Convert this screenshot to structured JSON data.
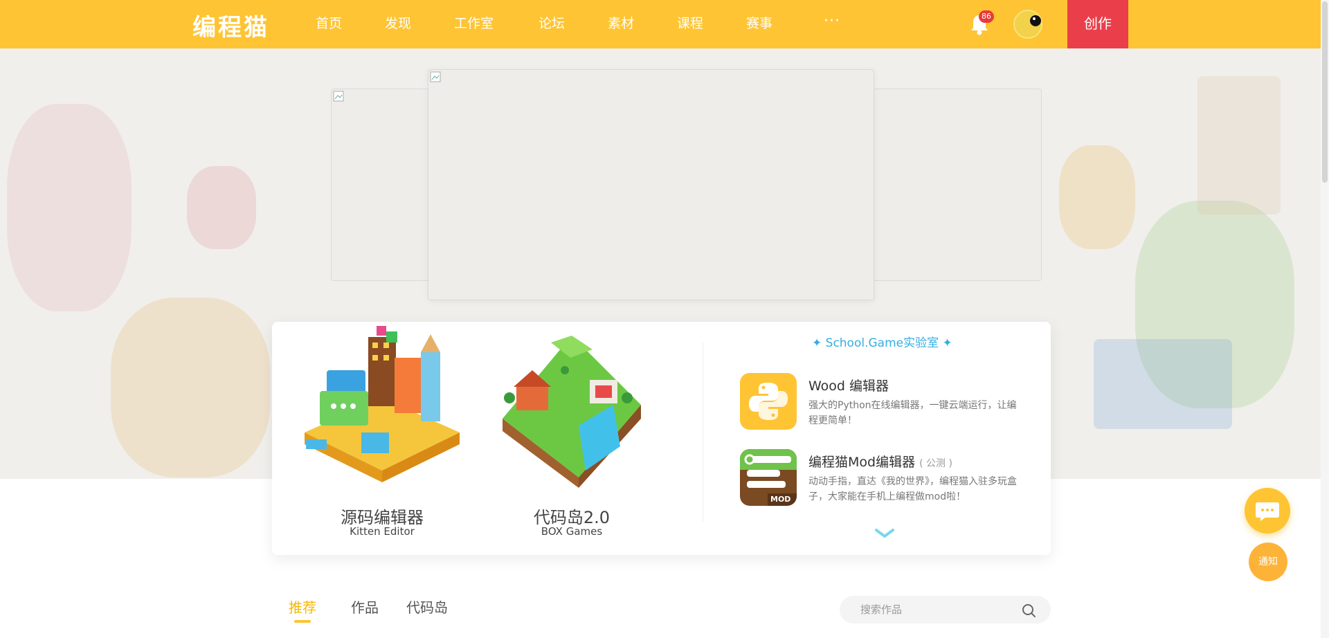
{
  "header": {
    "logo": "编程猫",
    "nav": [
      "首页",
      "发现",
      "工作室",
      "论坛",
      "素材",
      "课程",
      "赛事"
    ],
    "more": "···",
    "notification_count": "86",
    "create_label": "创作",
    "brand_color": "#fec433",
    "create_color": "#ea3f4a"
  },
  "products": [
    {
      "name": "源码编辑器",
      "sub": "Kitten Editor"
    },
    {
      "name": "代码岛2.0",
      "sub": "BOX Games"
    }
  ],
  "school": {
    "title": "✦ School.Game实验室 ✦",
    "tools": [
      {
        "name": "Wood 编辑器",
        "tag": "",
        "desc": "强大的Python在线编辑器，一键云端运行，让编程更简单！",
        "icon": "python-icon"
      },
      {
        "name": "编程猫Mod编辑器",
        "tag": "( 公测 )",
        "desc": "动动手指，直达《我的世界》，编程猫入驻多玩盒子，大家能在手机上编程做mod啦！",
        "icon": "mod-icon",
        "icon_text": "MOD"
      }
    ]
  },
  "floating": {
    "notify_label": "通知"
  },
  "tabs": [
    "推荐",
    "作品",
    "代码岛"
  ],
  "search": {
    "placeholder": "搜索作品"
  }
}
